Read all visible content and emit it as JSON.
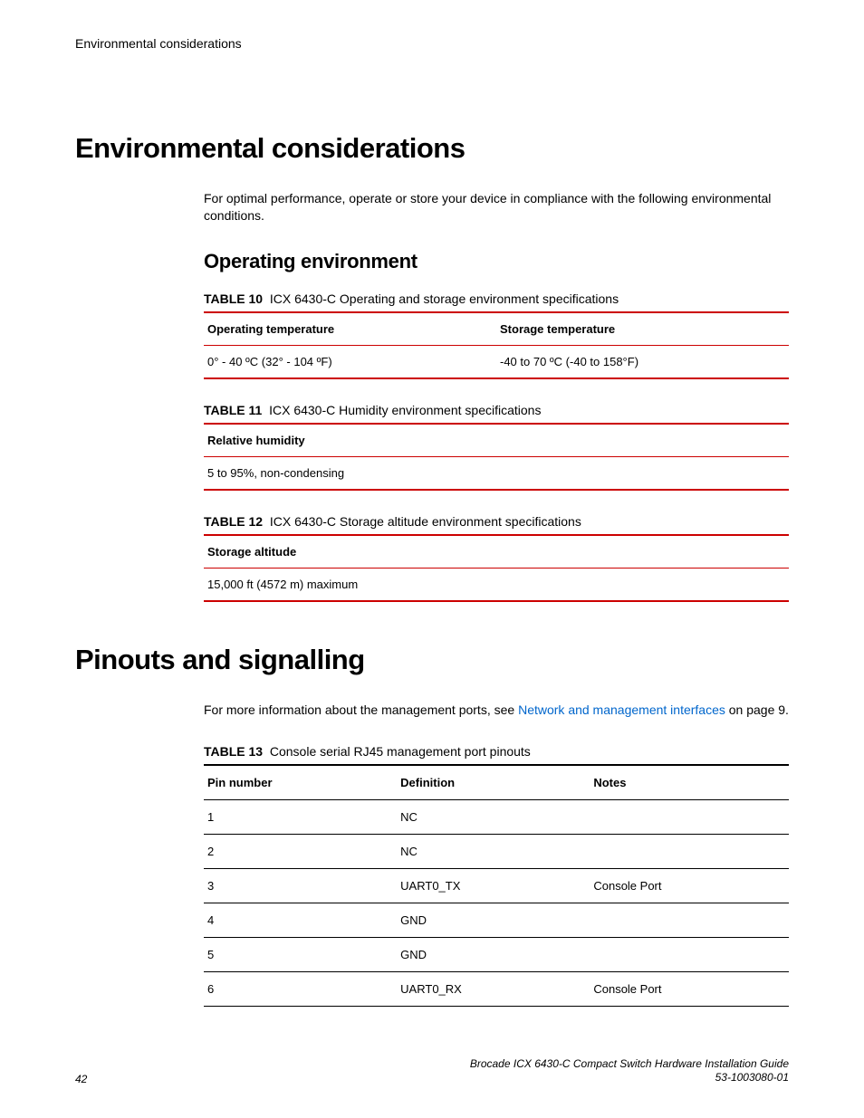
{
  "runningHead": "Environmental considerations",
  "h1a": "Environmental considerations",
  "introA": "For optimal performance, operate or store your device in compliance with the following environmental conditions.",
  "h2a": "Operating environment",
  "table10": {
    "label": "TABLE 10",
    "caption": "ICX 6430-C Operating and storage environment specifications",
    "head1": "Operating temperature",
    "head2": "Storage temperature",
    "cell1": "0° - 40 ºC (32° - 104 ºF)",
    "cell2": "-40 to 70 ºC (-40 to 158°F)"
  },
  "table11": {
    "label": "TABLE 11",
    "caption": "ICX 6430-C Humidity environment specifications",
    "head1": "Relative humidity",
    "cell1": "5 to 95%, non-condensing"
  },
  "table12": {
    "label": "TABLE 12",
    "caption": "ICX 6430-C Storage altitude environment specifications",
    "head1": "Storage altitude",
    "cell1": "15,000 ft (4572 m) maximum"
  },
  "h1b": "Pinouts and signalling",
  "introB_pre": "For more information about the management ports, see ",
  "introB_link": "Network and management interfaces",
  "introB_post": " on page 9.",
  "table13": {
    "label": "TABLE 13",
    "caption": "Console serial RJ45 management port pinouts",
    "head1": "Pin number",
    "head2": "Definition",
    "head3": "Notes",
    "rows": [
      {
        "pin": "1",
        "def": "NC",
        "notes": ""
      },
      {
        "pin": "2",
        "def": "NC",
        "notes": ""
      },
      {
        "pin": "3",
        "def": "UART0_TX",
        "notes": "Console Port"
      },
      {
        "pin": "4",
        "def": "GND",
        "notes": ""
      },
      {
        "pin": "5",
        "def": "GND",
        "notes": ""
      },
      {
        "pin": "6",
        "def": "UART0_RX",
        "notes": "Console Port"
      }
    ]
  },
  "footer": {
    "page": "42",
    "title": "Brocade ICX 6430-C Compact Switch Hardware Installation Guide",
    "docnum": "53-1003080-01"
  }
}
